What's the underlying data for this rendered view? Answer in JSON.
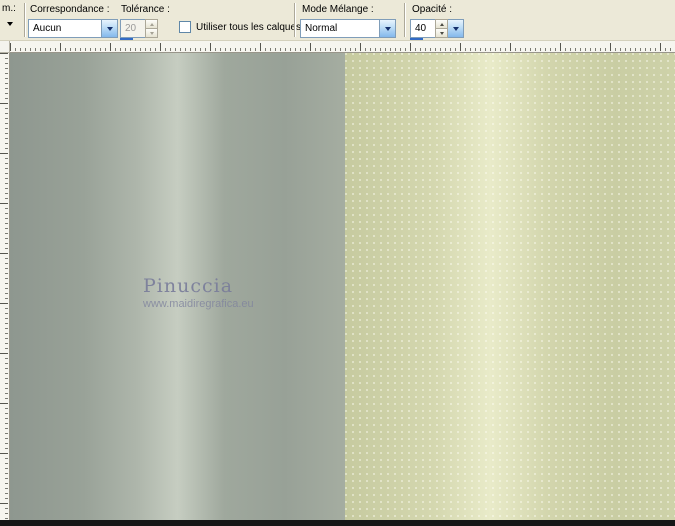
{
  "colors": {
    "toolbar_bg": "#ece9d8",
    "accent_blue": "#316ac5",
    "combo_border": "#7f9db9",
    "canvas_left_base": "#97a098",
    "canvas_left_highlight": "#c6cdc1",
    "canvas_right_base": "#cdd1a7",
    "canvas_right_highlight": "#e9ebc9"
  },
  "toolbar": {
    "partial_label": "m.:",
    "correspondance_label": "Correspondance :",
    "correspondance_value": "Aucun",
    "tolerance_label": "Tolérance :",
    "tolerance_value": "20",
    "tolerance_disabled": true,
    "use_all_layers_label": "Utiliser tous les calques",
    "use_all_layers_checked": false,
    "mode_label": "Mode Mélange :",
    "mode_value": "Normal",
    "opacity_label": "Opacité :",
    "opacity_value": "40"
  },
  "canvas": {
    "watermark_title": "Pinuccia",
    "watermark_url": "www.maidiregrafica.eu"
  }
}
